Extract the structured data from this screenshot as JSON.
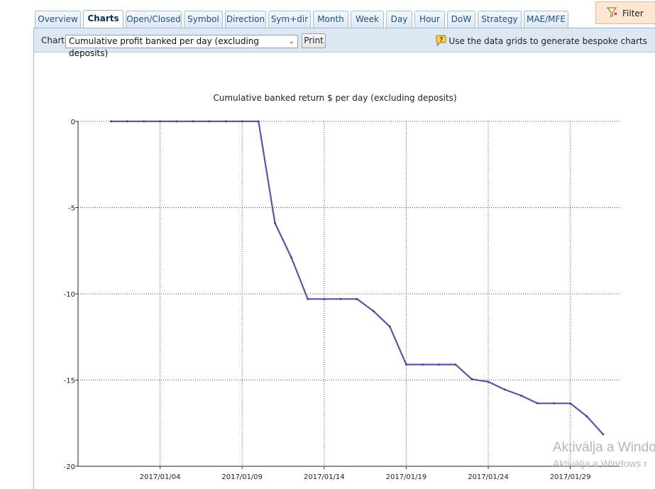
{
  "tabs": [
    {
      "label": "Overview"
    },
    {
      "label": "Charts"
    },
    {
      "label": "Open/Closed"
    },
    {
      "label": "Symbol"
    },
    {
      "label": "Direction"
    },
    {
      "label": "Sym+dir"
    },
    {
      "label": "Month"
    },
    {
      "label": "Week"
    },
    {
      "label": "Day"
    },
    {
      "label": "Hour"
    },
    {
      "label": "DoW"
    },
    {
      "label": "Strategy"
    },
    {
      "label": "MAE/MFE"
    }
  ],
  "active_tab": "Charts",
  "filter": {
    "label": "Filter",
    "icon": "funnel-icon"
  },
  "toolbar": {
    "chart_label": "Chart:",
    "chart_select_value": "Cumulative profit banked per day (excluding deposits)",
    "print_label": "Print",
    "hint_text": "Use the data grids to generate bespoke charts",
    "hint_icon": "help-bubble-icon"
  },
  "chart_data": {
    "type": "line",
    "title": "Cumulative banked return $ per day (excluding deposits)",
    "xlabel": "",
    "ylabel": "",
    "ylim": [
      -20,
      0
    ],
    "yticks": [
      0,
      -5,
      -10,
      -15,
      -20
    ],
    "xticks": [
      "2017/01/04",
      "2017/01/09",
      "2017/01/14",
      "2017/01/19",
      "2017/01/24",
      "2017/01/29"
    ],
    "xlim": [
      "2016/12/30",
      "2017/02/01"
    ],
    "grid": true,
    "line_color": "#5b55a6",
    "series": [
      {
        "x": [
          "2017/01/01",
          "2017/01/02",
          "2017/01/03",
          "2017/01/04",
          "2017/01/05",
          "2017/01/06",
          "2017/01/07",
          "2017/01/08",
          "2017/01/09",
          "2017/01/10",
          "2017/01/11",
          "2017/01/12",
          "2017/01/13",
          "2017/01/14",
          "2017/01/15",
          "2017/01/16",
          "2017/01/17",
          "2017/01/18",
          "2017/01/19",
          "2017/01/20",
          "2017/01/21",
          "2017/01/22",
          "2017/01/23",
          "2017/01/24",
          "2017/01/25",
          "2017/01/26",
          "2017/01/27",
          "2017/01/28",
          "2017/01/29",
          "2017/01/30",
          "2017/01/31"
        ],
        "values": [
          0,
          0,
          0,
          0,
          0,
          0,
          0,
          0,
          0,
          0,
          -5.9,
          -7.9,
          -10.3,
          -10.3,
          -10.3,
          -10.3,
          -11,
          -11.9,
          -14.1,
          -14.1,
          -14.1,
          -14.1,
          -14.95,
          -15.1,
          -15.55,
          -15.9,
          -16.35,
          -16.35,
          -16.35,
          -17.1,
          -18.15
        ]
      }
    ]
  },
  "watermark": {
    "line1": "Aktiválja a Windo",
    "line2": "Aktiválja a Windows r"
  }
}
